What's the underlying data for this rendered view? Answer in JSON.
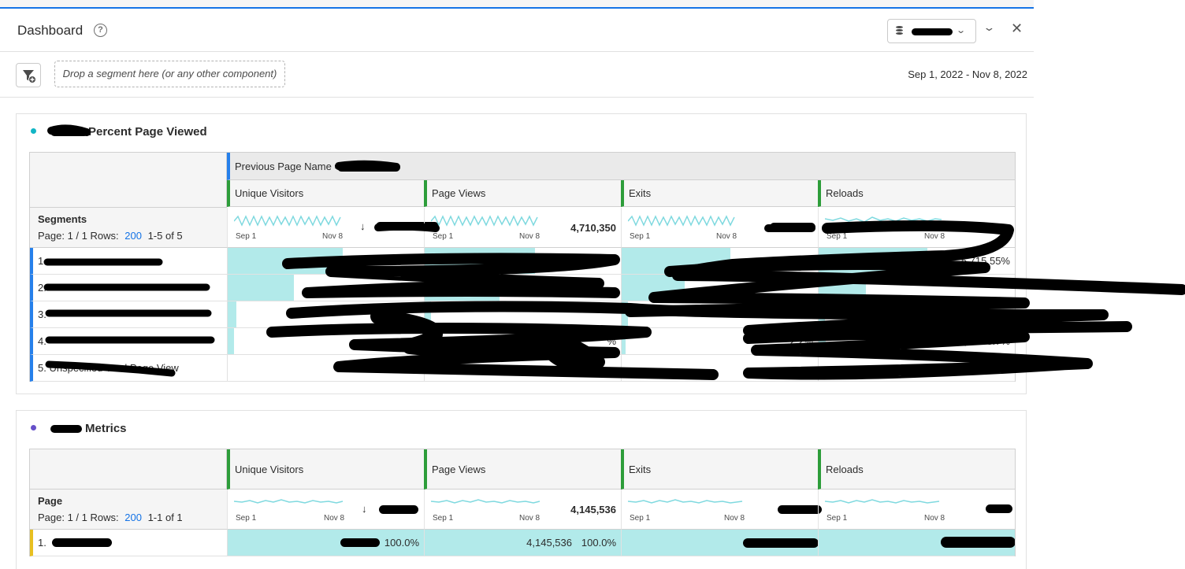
{
  "header": {
    "title": "Dashboard",
    "help_icon": "?",
    "collapse_icon": "⌄",
    "close_icon": "✕"
  },
  "segment_bar": {
    "drop_placeholder": "Drop a segment here (or any other component)",
    "date_range": "Sep 1, 2022 - Nov 8, 2022"
  },
  "panel1": {
    "title_suffix": "Percent Page Viewed",
    "dot_color": "#12b5c5",
    "breakdown_header": "Previous Page Name =",
    "columns": [
      "Unique Visitors",
      "Page Views",
      "Exits",
      "Reloads"
    ],
    "dim_label": "Segments",
    "page_label": "Page: 1 / 1 Rows:",
    "rows_count": "200",
    "range_label": "1-5 of 5",
    "spark_start": "Sep 1",
    "spark_end": "Nov 8",
    "page_views_total": "4,710,350",
    "row_numbers": [
      "1.",
      "2.",
      "3.",
      "4.",
      "5."
    ],
    "row5_visible": "Unspecified Total Page View",
    "fragments": {
      "r1_reloads": "5,715   55%",
      "r4_pv": "%",
      "r4_exits": "2.2%",
      "r4_reloads": "3,854   3.7%",
      "r5_uv": "0.3%"
    }
  },
  "panel2": {
    "title_suffix": "Metrics",
    "dot_color": "#6650c9",
    "columns": [
      "Unique Visitors",
      "Page Views",
      "Exits",
      "Reloads"
    ],
    "dim_label": "Page",
    "page_label": "Page: 1 / 1 Rows:",
    "rows_count": "200",
    "range_label": "1-1 of 1",
    "spark_start": "Sep 1",
    "spark_end": "Nov 8",
    "page_views_total": "4,145,536",
    "row_number": "1.",
    "row_uv_pct": "100.0%",
    "row_pv": "4,145,536",
    "row_pv_pct": "100.0%"
  }
}
